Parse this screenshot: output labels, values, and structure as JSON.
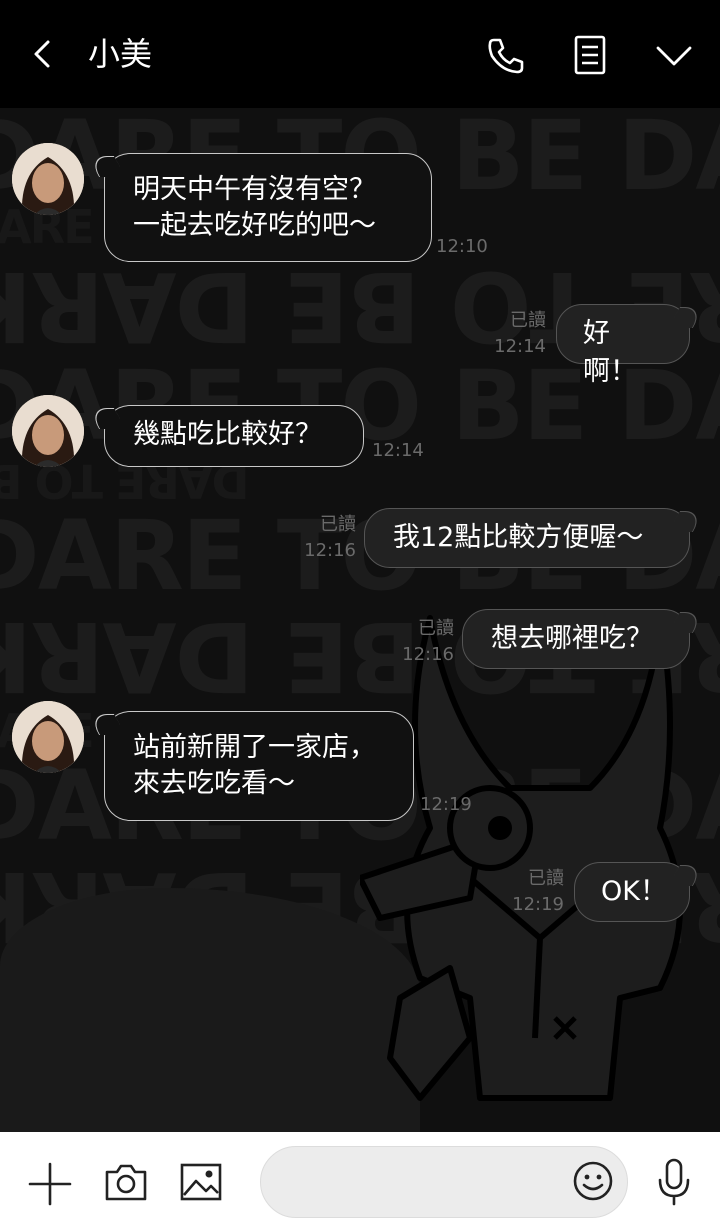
{
  "header": {
    "title": "小美",
    "back_icon": "chevron-left-icon",
    "call_icon": "phone-icon",
    "memo_icon": "notes-icon",
    "menu_icon": "chevron-down-icon"
  },
  "wallpaper": {
    "text_big": "DARE TO BE DARK",
    "text_small": "DARE TO BE"
  },
  "messages": [
    {
      "dir": "in",
      "text": "明天中午有沒有空？\n一起去吃好吃的吧～",
      "time": "12:10"
    },
    {
      "dir": "out",
      "text": "好啊！",
      "read": "已讀",
      "time": "12:14"
    },
    {
      "dir": "in",
      "text": "幾點吃比較好？",
      "time": "12:14"
    },
    {
      "dir": "out",
      "text": "我12點比較方便喔～",
      "read": "已讀",
      "time": "12:16"
    },
    {
      "dir": "out",
      "text": "想去哪裡吃？",
      "read": "已讀",
      "time": "12:16"
    },
    {
      "dir": "in",
      "text": "站前新開了一家店，\n來去吃吃看～",
      "time": "12:19"
    },
    {
      "dir": "out",
      "text": "OK！",
      "read": "已讀",
      "time": "12:19"
    }
  ],
  "footer": {
    "input_value": "",
    "icons": [
      "plus-icon",
      "camera-icon",
      "image-icon",
      "emoji-icon",
      "microphone-icon"
    ]
  },
  "colors": {
    "header_bg": "#000000",
    "bubble_in_border": "#c8c8c8",
    "bubble_out_bg": "#222222",
    "footer_bg": "#ffffff"
  }
}
